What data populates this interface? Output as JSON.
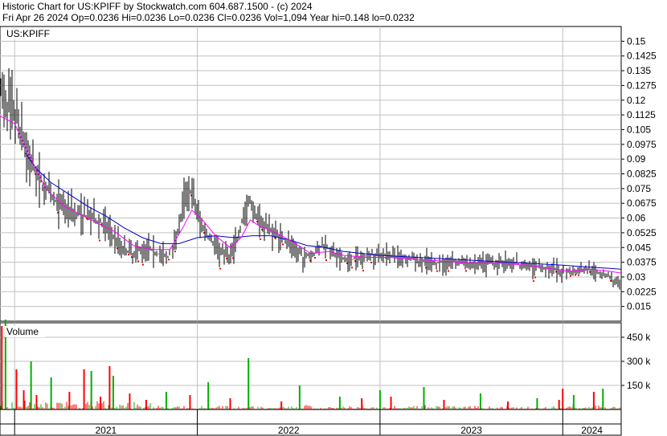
{
  "header": {
    "title_line": "Historic Chart for US:KPIFF by Stockwatch.com 604.687.1500 - (c) 2024",
    "quote_line": "Fri Apr 26 2024   Op=0.0236   Hi=0.0236   Lo=0.0236   Cl=0.0236   Vol=1,094   Year hi=0.148   lo=0.0232"
  },
  "chart_data": [
    {
      "type": "line",
      "title": "US:KPIFF",
      "symbol": "US:KPIFF",
      "ylim": [
        0.0075,
        0.1575
      ],
      "y_ticks": [
        "0.15",
        "0.1425",
        "0.135",
        "0.1275",
        "0.12",
        "0.1125",
        "0.105",
        "0.0975",
        "0.09",
        "0.0825",
        "0.075",
        "0.0675",
        "0.06",
        "0.0525",
        "0.045",
        "0.0375",
        "0.03",
        "0.0225",
        "0.015"
      ],
      "x_labels": [
        "2021",
        "2022",
        "2023",
        "2024"
      ],
      "grid": true,
      "colors": {
        "price_bar": "#000000",
        "ma_fast": "#ff00ff",
        "ma_slow": "#0000cc",
        "red_dot": "#ff0000"
      },
      "series": [
        {
          "name": "price",
          "points": [
            [
              2020.92,
              0.125
            ],
            [
              2020.96,
              0.118
            ],
            [
              2021.0,
              0.112
            ],
            [
              2021.04,
              0.103
            ],
            [
              2021.08,
              0.09
            ],
            [
              2021.13,
              0.08
            ],
            [
              2021.17,
              0.075
            ],
            [
              2021.21,
              0.07
            ],
            [
              2021.27,
              0.066
            ],
            [
              2021.33,
              0.063
            ],
            [
              2021.42,
              0.06
            ],
            [
              2021.5,
              0.056
            ],
            [
              2021.55,
              0.05
            ],
            [
              2021.6,
              0.044
            ],
            [
              2021.65,
              0.042
            ],
            [
              2021.72,
              0.046
            ],
            [
              2021.78,
              0.042
            ],
            [
              2021.84,
              0.04
            ],
            [
              2021.88,
              0.05
            ],
            [
              2021.91,
              0.06
            ],
            [
              2021.94,
              0.077
            ],
            [
              2021.97,
              0.072
            ],
            [
              2022.02,
              0.057
            ],
            [
              2022.08,
              0.048
            ],
            [
              2022.14,
              0.043
            ],
            [
              2022.18,
              0.041
            ],
            [
              2022.22,
              0.05
            ],
            [
              2022.26,
              0.063
            ],
            [
              2022.29,
              0.068
            ],
            [
              2022.33,
              0.06
            ],
            [
              2022.39,
              0.055
            ],
            [
              2022.45,
              0.051
            ],
            [
              2022.52,
              0.045
            ],
            [
              2022.58,
              0.04
            ],
            [
              2022.64,
              0.042
            ],
            [
              2022.7,
              0.047
            ],
            [
              2022.76,
              0.04
            ],
            [
              2022.82,
              0.038
            ],
            [
              2022.9,
              0.04
            ],
            [
              2022.98,
              0.042
            ],
            [
              2023.06,
              0.041
            ],
            [
              2023.14,
              0.04
            ],
            [
              2023.22,
              0.038
            ],
            [
              2023.3,
              0.037
            ],
            [
              2023.38,
              0.038
            ],
            [
              2023.46,
              0.037
            ],
            [
              2023.54,
              0.036
            ],
            [
              2023.62,
              0.037
            ],
            [
              2023.7,
              0.038
            ],
            [
              2023.78,
              0.036
            ],
            [
              2023.86,
              0.035
            ],
            [
              2023.94,
              0.034
            ],
            [
              2024.0,
              0.033
            ],
            [
              2024.06,
              0.032
            ],
            [
              2024.12,
              0.034
            ],
            [
              2024.18,
              0.033
            ],
            [
              2024.24,
              0.031
            ],
            [
              2024.3,
              0.026
            ],
            [
              2024.32,
              0.024
            ]
          ]
        },
        {
          "name": "ma_fast",
          "points": [
            [
              2020.92,
              0.112
            ],
            [
              2021.0,
              0.108
            ],
            [
              2021.08,
              0.092
            ],
            [
              2021.17,
              0.075
            ],
            [
              2021.27,
              0.066
            ],
            [
              2021.4,
              0.06
            ],
            [
              2021.55,
              0.053
            ],
            [
              2021.65,
              0.046
            ],
            [
              2021.75,
              0.044
            ],
            [
              2021.85,
              0.044
            ],
            [
              2021.92,
              0.055
            ],
            [
              2021.97,
              0.064
            ],
            [
              2022.02,
              0.06
            ],
            [
              2022.1,
              0.051
            ],
            [
              2022.18,
              0.045
            ],
            [
              2022.24,
              0.05
            ],
            [
              2022.29,
              0.059
            ],
            [
              2022.34,
              0.056
            ],
            [
              2022.42,
              0.053
            ],
            [
              2022.52,
              0.048
            ],
            [
              2022.62,
              0.042
            ],
            [
              2022.72,
              0.043
            ],
            [
              2022.8,
              0.041
            ],
            [
              2022.92,
              0.04
            ],
            [
              2023.05,
              0.04
            ],
            [
              2023.2,
              0.039
            ],
            [
              2023.35,
              0.038
            ],
            [
              2023.5,
              0.037
            ],
            [
              2023.65,
              0.037
            ],
            [
              2023.8,
              0.036
            ],
            [
              2023.95,
              0.034
            ],
            [
              2024.05,
              0.033
            ],
            [
              2024.15,
              0.034
            ],
            [
              2024.25,
              0.033
            ],
            [
              2024.32,
              0.032
            ]
          ]
        },
        {
          "name": "ma_slow",
          "points": [
            [
              2021.06,
              0.093
            ],
            [
              2021.12,
              0.085
            ],
            [
              2021.2,
              0.078
            ],
            [
              2021.3,
              0.072
            ],
            [
              2021.4,
              0.066
            ],
            [
              2021.5,
              0.061
            ],
            [
              2021.6,
              0.055
            ],
            [
              2021.7,
              0.05
            ],
            [
              2021.8,
              0.047
            ],
            [
              2021.9,
              0.047
            ],
            [
              2022.0,
              0.05
            ],
            [
              2022.1,
              0.051
            ],
            [
              2022.2,
              0.05
            ],
            [
              2022.3,
              0.051
            ],
            [
              2022.4,
              0.051
            ],
            [
              2022.5,
              0.049
            ],
            [
              2022.6,
              0.046
            ],
            [
              2022.7,
              0.045
            ],
            [
              2022.8,
              0.043
            ],
            [
              2022.9,
              0.042
            ],
            [
              2023.0,
              0.041
            ],
            [
              2023.2,
              0.04
            ],
            [
              2023.4,
              0.039
            ],
            [
              2023.6,
              0.038
            ],
            [
              2023.8,
              0.037
            ],
            [
              2024.0,
              0.036
            ],
            [
              2024.15,
              0.035
            ],
            [
              2024.32,
              0.034
            ]
          ]
        }
      ]
    },
    {
      "type": "bar",
      "title": "Volume",
      "ylim": [
        0,
        540000
      ],
      "y_ticks": [
        "450 k",
        "300 k",
        "150 k"
      ],
      "colors": {
        "up": "#ff0000",
        "down": "#00b000"
      },
      "series": [
        {
          "name": "up",
          "values": [
            [
              2020.93,
              520000
            ],
            [
              2021.01,
              250000
            ],
            [
              2021.05,
              120000
            ],
            [
              2021.12,
              90000
            ],
            [
              2021.3,
              110000
            ],
            [
              2021.38,
              250000
            ],
            [
              2021.47,
              80000
            ],
            [
              2021.52,
              270000
            ],
            [
              2021.63,
              100000
            ],
            [
              2021.72,
              60000
            ],
            [
              2021.96,
              90000
            ],
            [
              2022.18,
              70000
            ],
            [
              2022.46,
              50000
            ],
            [
              2022.9,
              70000
            ],
            [
              2023.06,
              80000
            ],
            [
              2023.35,
              60000
            ],
            [
              2023.7,
              50000
            ],
            [
              2023.98,
              60000
            ],
            [
              2024.0,
              130000
            ],
            [
              2024.17,
              110000
            ]
          ]
        },
        {
          "name": "down",
          "values": [
            [
              2020.95,
              560000
            ],
            [
              2021.09,
              300000
            ],
            [
              2021.2,
              200000
            ],
            [
              2021.42,
              240000
            ],
            [
              2021.54,
              210000
            ],
            [
              2021.83,
              110000
            ],
            [
              2022.06,
              170000
            ],
            [
              2022.28,
              320000
            ],
            [
              2022.56,
              150000
            ],
            [
              2022.78,
              80000
            ],
            [
              2023.0,
              120000
            ],
            [
              2023.24,
              140000
            ],
            [
              2023.55,
              100000
            ],
            [
              2023.86,
              70000
            ],
            [
              2024.06,
              90000
            ],
            [
              2024.22,
              130000
            ]
          ]
        }
      ]
    }
  ]
}
